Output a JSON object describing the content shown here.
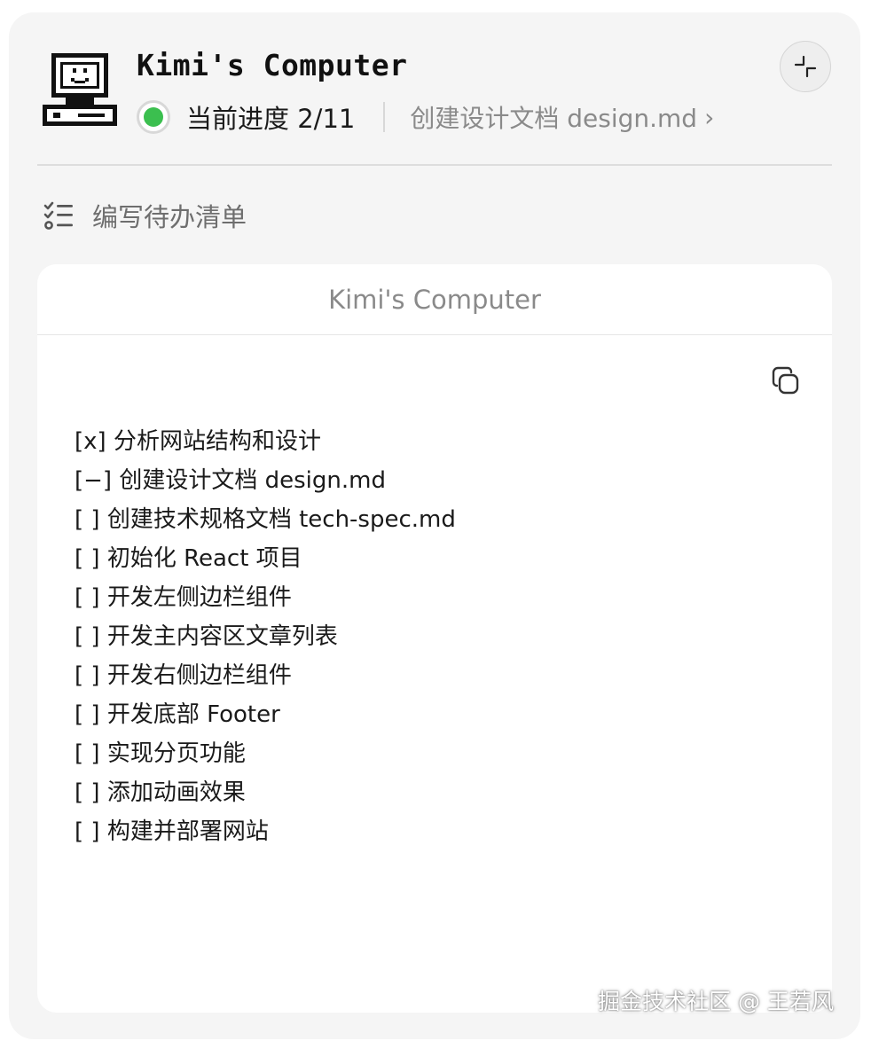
{
  "header": {
    "title": "Kimi's Computer",
    "progress_label": "当前进度 2/11",
    "current_step": "创建设计文档 design.md",
    "status_color": "#3bbf4f",
    "logo_icon": "retro-computer-icon",
    "expand_icon": "expand-icon"
  },
  "task": {
    "icon": "checklist-icon",
    "label": "编写待办清单"
  },
  "card": {
    "title": "Kimi's Computer",
    "copy_icon": "copy-icon",
    "items": [
      "[x] 分析网站结构和设计",
      "[−] 创建设计文档 design.md",
      "[  ] 创建技术规格文档 tech-spec.md",
      "[  ] 初始化 React 项目",
      "[  ] 开发左侧边栏组件",
      "[  ] 开发主内容区文章列表",
      "[  ] 开发右侧边栏组件",
      "[  ] 开发底部 Footer",
      "[  ] 实现分页功能",
      "[  ] 添加动画效果",
      "[  ] 构建并部署网站"
    ]
  },
  "watermark": "掘金技术社区 @ 王若风"
}
